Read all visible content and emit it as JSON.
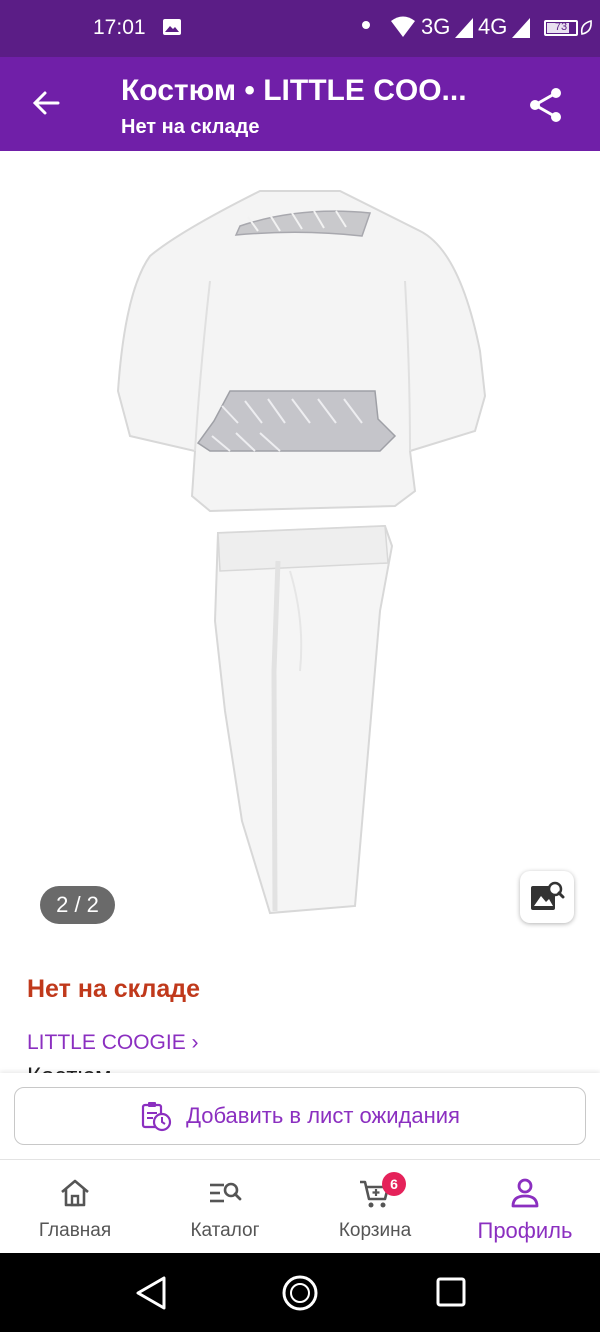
{
  "status_bar": {
    "time": "17:01",
    "network_1": "3G",
    "network_2": "4G",
    "battery": "73",
    "battery_level": 0.73,
    "background_color": "#5b1d86"
  },
  "app_bar": {
    "title": "Костюм • LITTLE COO...",
    "subtitle": "Нет на складе",
    "background_color": "#701fa8",
    "back_icon": "arrow-left-icon",
    "share_icon": "share-icon"
  },
  "gallery": {
    "counter": "2 / 2",
    "photo_search_icon": "image-search-icon"
  },
  "product": {
    "stock_status": "Нет на складе",
    "brand_link": "LITTLE COOGIE ›",
    "name_partial": "Костюм"
  },
  "waitlist": {
    "label": "Добавить в лист ожидания",
    "icon": "clipboard-clock-icon"
  },
  "bottom_nav": {
    "items": [
      {
        "label": "Главная",
        "icon": "home-icon"
      },
      {
        "label": "Каталог",
        "icon": "catalog-search-icon"
      },
      {
        "label": "Корзина",
        "icon": "cart-icon",
        "badge": "6"
      },
      {
        "label": "Профиль",
        "icon": "profile-icon",
        "active": true
      }
    ],
    "accent_color": "#8b2fc0"
  },
  "colors": {
    "accent": "#8b2fc0",
    "out_of_stock": "#c0391b",
    "badge": "#e5225a"
  }
}
